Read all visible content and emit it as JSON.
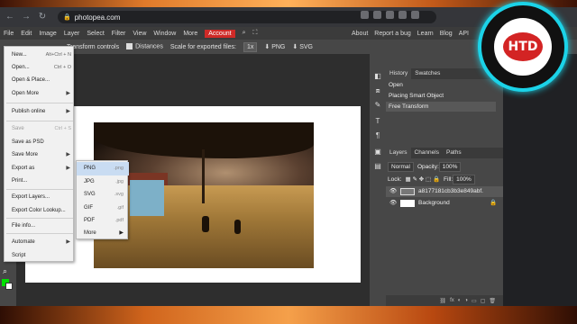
{
  "browser": {
    "url": "photopea.com"
  },
  "menubar": {
    "items": [
      "File",
      "Edit",
      "Image",
      "Layer",
      "Select",
      "Filter",
      "View",
      "Window",
      "More"
    ],
    "account": "Account",
    "right": [
      "About",
      "Report a bug",
      "Learn",
      "Blog",
      "API"
    ]
  },
  "toolbar": {
    "transform": "Transform controls",
    "distances": "Distances",
    "scale_label": "Scale for exported files:",
    "scale_value": "1x",
    "png": "PNG",
    "svg": "SVG"
  },
  "file_menu": [
    {
      "label": "New...",
      "shortcut": "Alt+Ctrl + N"
    },
    {
      "label": "Open...",
      "shortcut": "Ctrl + O"
    },
    {
      "label": "Open & Place..."
    },
    {
      "label": "Open More",
      "submenu": true
    },
    {
      "label": "Publish online",
      "submenu": true
    },
    {
      "label": "Save",
      "shortcut": "Ctrl + S",
      "disabled": true
    },
    {
      "label": "Save as PSD"
    },
    {
      "label": "Save More",
      "submenu": true
    },
    {
      "label": "Export as",
      "submenu": true
    },
    {
      "label": "Print..."
    },
    {
      "label": "Export Layers..."
    },
    {
      "label": "Export Color Lookup..."
    },
    {
      "label": "File info..."
    },
    {
      "label": "Automate",
      "submenu": true
    },
    {
      "label": "Script"
    }
  ],
  "export_menu": [
    {
      "label": "PNG",
      "ext": ".png",
      "active": true
    },
    {
      "label": "JPG",
      "ext": ".jpg"
    },
    {
      "label": "SVG",
      "ext": ".svg"
    },
    {
      "label": "GIF",
      "ext": ".gif"
    },
    {
      "label": "PDF",
      "ext": ".pdf"
    },
    {
      "label": "More",
      "submenu": true
    }
  ],
  "history": {
    "tabs": [
      "History",
      "Swatches"
    ],
    "items": [
      "Open",
      "Placing Smart Object",
      "Free Transform"
    ]
  },
  "layers": {
    "tabs": [
      "Layers",
      "Channels",
      "Paths"
    ],
    "blend": "Normal",
    "opacity_label": "Opacity:",
    "opacity": "100%",
    "lock_label": "Lock:",
    "fill_label": "Fill:",
    "fill": "100%",
    "items": [
      {
        "name": "a8177181cb3b3e849abf.",
        "selected": true
      },
      {
        "name": "Background",
        "locked": true
      }
    ]
  },
  "logo": {
    "text": "HTD"
  },
  "colors": {
    "account": "#cf2a27",
    "logo_ring": "#1bd3e8",
    "logo_center": "#d32424"
  }
}
